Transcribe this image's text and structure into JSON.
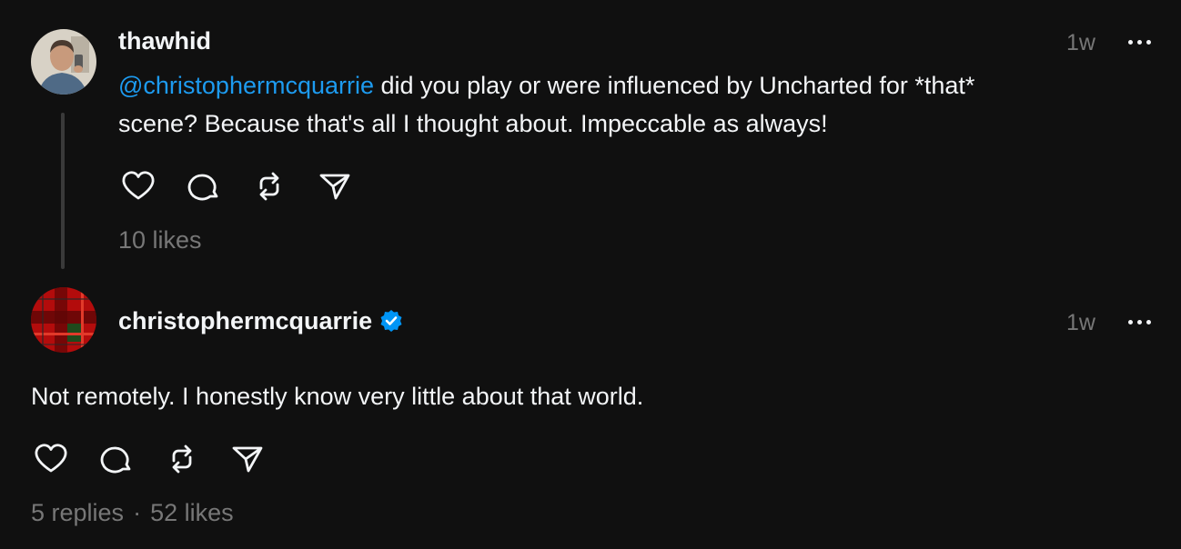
{
  "posts": [
    {
      "username": "thawhid",
      "verified": false,
      "time": "1w",
      "mention": "@christophermcquarrie",
      "text_line1": " did you play or were influenced by Uncharted for *that*",
      "text_line2": "scene? Because that's all I thought about. Impeccable as always!",
      "likes": "10 likes"
    },
    {
      "username": "christophermcquarrie",
      "verified": true,
      "time": "1w",
      "text": "Not remotely. I honestly know very little about that world.",
      "replies": "5 replies",
      "separator": "·",
      "likes": "52 likes"
    }
  ],
  "icons": {
    "like": "heart-icon",
    "reply": "comment-icon",
    "repost": "repost-icon",
    "share": "send-icon",
    "more": "more-horizontal-icon",
    "verified": "verified-badge-icon"
  },
  "colors": {
    "background": "#101010",
    "text": "#f3f5f7",
    "muted": "#777777",
    "mention": "#1d9bf0",
    "verified": "#0095f6"
  }
}
